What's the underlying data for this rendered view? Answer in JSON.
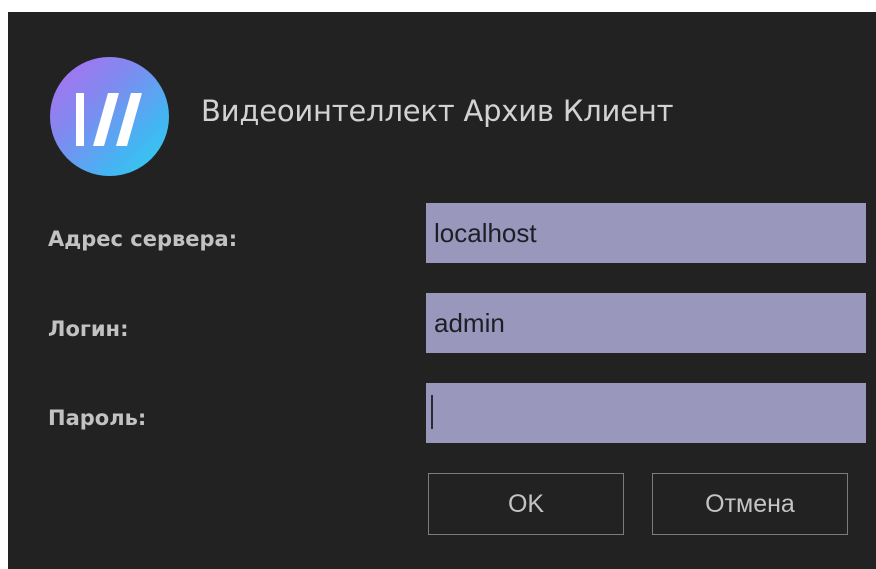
{
  "app": {
    "title": "Видеоинтеллект Архив Клиент",
    "logo_icon": "slash-logo-icon"
  },
  "form": {
    "server_label": "Адрес сервера:",
    "server_value": "localhost",
    "login_label": "Логин:",
    "login_value": "admin",
    "password_label": "Пароль:",
    "password_value": ""
  },
  "buttons": {
    "ok_label": "OK",
    "cancel_label": "Отмена"
  },
  "colors": {
    "background": "#222222",
    "field_fill": "#9997bb",
    "label_text": "#c2c2c2",
    "button_border": "#7c7c7c",
    "logo_gradient_start": "#b06cf0",
    "logo_gradient_end": "#2fd0f0"
  }
}
